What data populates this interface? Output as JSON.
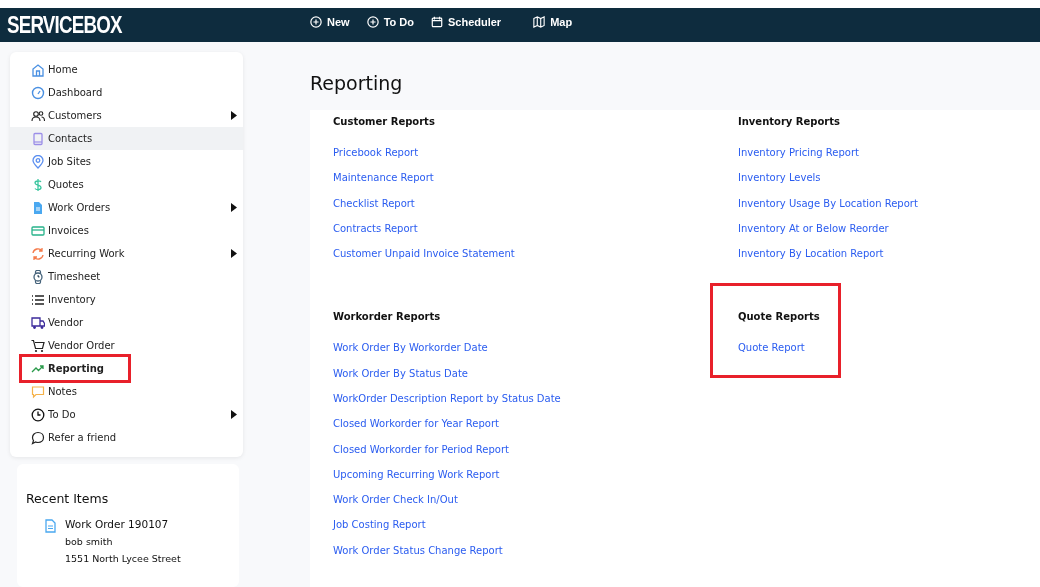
{
  "brand": "SERVICEBOX",
  "nav": [
    {
      "label": "New",
      "kind": "plus"
    },
    {
      "label": "To Do",
      "kind": "plus"
    },
    {
      "label": "Scheduler",
      "kind": "calendar"
    },
    {
      "label": "Map",
      "kind": "map"
    }
  ],
  "sidebar": {
    "items": [
      {
        "label": "Home",
        "kind": "home",
        "submenu": false,
        "hovered": false,
        "selected": false,
        "annotated": false
      },
      {
        "label": "Dashboard",
        "kind": "gauge",
        "submenu": false,
        "hovered": false,
        "selected": false,
        "annotated": false
      },
      {
        "label": "Customers",
        "kind": "people",
        "submenu": true,
        "hovered": false,
        "selected": false,
        "annotated": false
      },
      {
        "label": "Contacts",
        "kind": "book",
        "submenu": false,
        "hovered": true,
        "selected": false,
        "annotated": false
      },
      {
        "label": "Job Sites",
        "kind": "pin",
        "submenu": false,
        "hovered": false,
        "selected": false,
        "annotated": false
      },
      {
        "label": "Quotes",
        "kind": "dollar",
        "submenu": false,
        "hovered": false,
        "selected": false,
        "annotated": false
      },
      {
        "label": "Work Orders",
        "kind": "doc",
        "submenu": true,
        "hovered": false,
        "selected": false,
        "annotated": false
      },
      {
        "label": "Invoices",
        "kind": "card",
        "submenu": false,
        "hovered": false,
        "selected": false,
        "annotated": false
      },
      {
        "label": "Recurring Work",
        "kind": "cycle",
        "submenu": true,
        "hovered": false,
        "selected": false,
        "annotated": false
      },
      {
        "label": "Timesheet",
        "kind": "watch",
        "submenu": false,
        "hovered": false,
        "selected": false,
        "annotated": false
      },
      {
        "label": "Inventory",
        "kind": "list",
        "submenu": false,
        "hovered": false,
        "selected": false,
        "annotated": false
      },
      {
        "label": "Vendor",
        "kind": "truck",
        "submenu": false,
        "hovered": false,
        "selected": false,
        "annotated": false
      },
      {
        "label": "Vendor Order",
        "kind": "cart",
        "submenu": false,
        "hovered": false,
        "selected": false,
        "annotated": false
      },
      {
        "label": "Reporting",
        "kind": "trend",
        "submenu": false,
        "hovered": false,
        "selected": true,
        "annotated": true
      },
      {
        "label": "Notes",
        "kind": "note",
        "submenu": false,
        "hovered": false,
        "selected": false,
        "annotated": false
      },
      {
        "label": "To Do",
        "kind": "clock",
        "submenu": true,
        "hovered": false,
        "selected": false,
        "annotated": false
      },
      {
        "label": "Refer a friend",
        "kind": "bubble",
        "submenu": false,
        "hovered": false,
        "selected": false,
        "annotated": false
      }
    ]
  },
  "recent_items": {
    "title": "Recent Items",
    "items": [
      {
        "title": "Work Order 190107",
        "lines": [
          "bob smith",
          "1551 North Lycee Street"
        ]
      }
    ]
  },
  "page_title": "Reporting",
  "report_groups": [
    {
      "title": "Customer Reports",
      "annotated": false,
      "links": [
        "Pricebook Report",
        "Maintenance Report",
        "Checklist Report",
        "Contracts Report",
        "Customer Unpaid Invoice Statement"
      ]
    },
    {
      "title": "Inventory Reports",
      "annotated": false,
      "links": [
        "Inventory Pricing Report",
        "Inventory Levels",
        "Inventory Usage By Location Report",
        "Inventory At or Below Reorder",
        "Inventory By Location Report"
      ]
    },
    {
      "title": "Workorder Reports",
      "annotated": false,
      "links": [
        "Work Order By Workorder Date",
        "Work Order By Status Date",
        "WorkOrder Description Report by Status Date",
        "Closed Workorder for Year Report",
        "Closed Workorder for Period Report",
        "Upcoming Recurring Work Report",
        "Work Order Check In/Out",
        "Job Costing Report",
        "Work Order Status Change Report"
      ]
    },
    {
      "title": "Quote Reports",
      "annotated": true,
      "links": [
        "Quote Report"
      ]
    }
  ]
}
